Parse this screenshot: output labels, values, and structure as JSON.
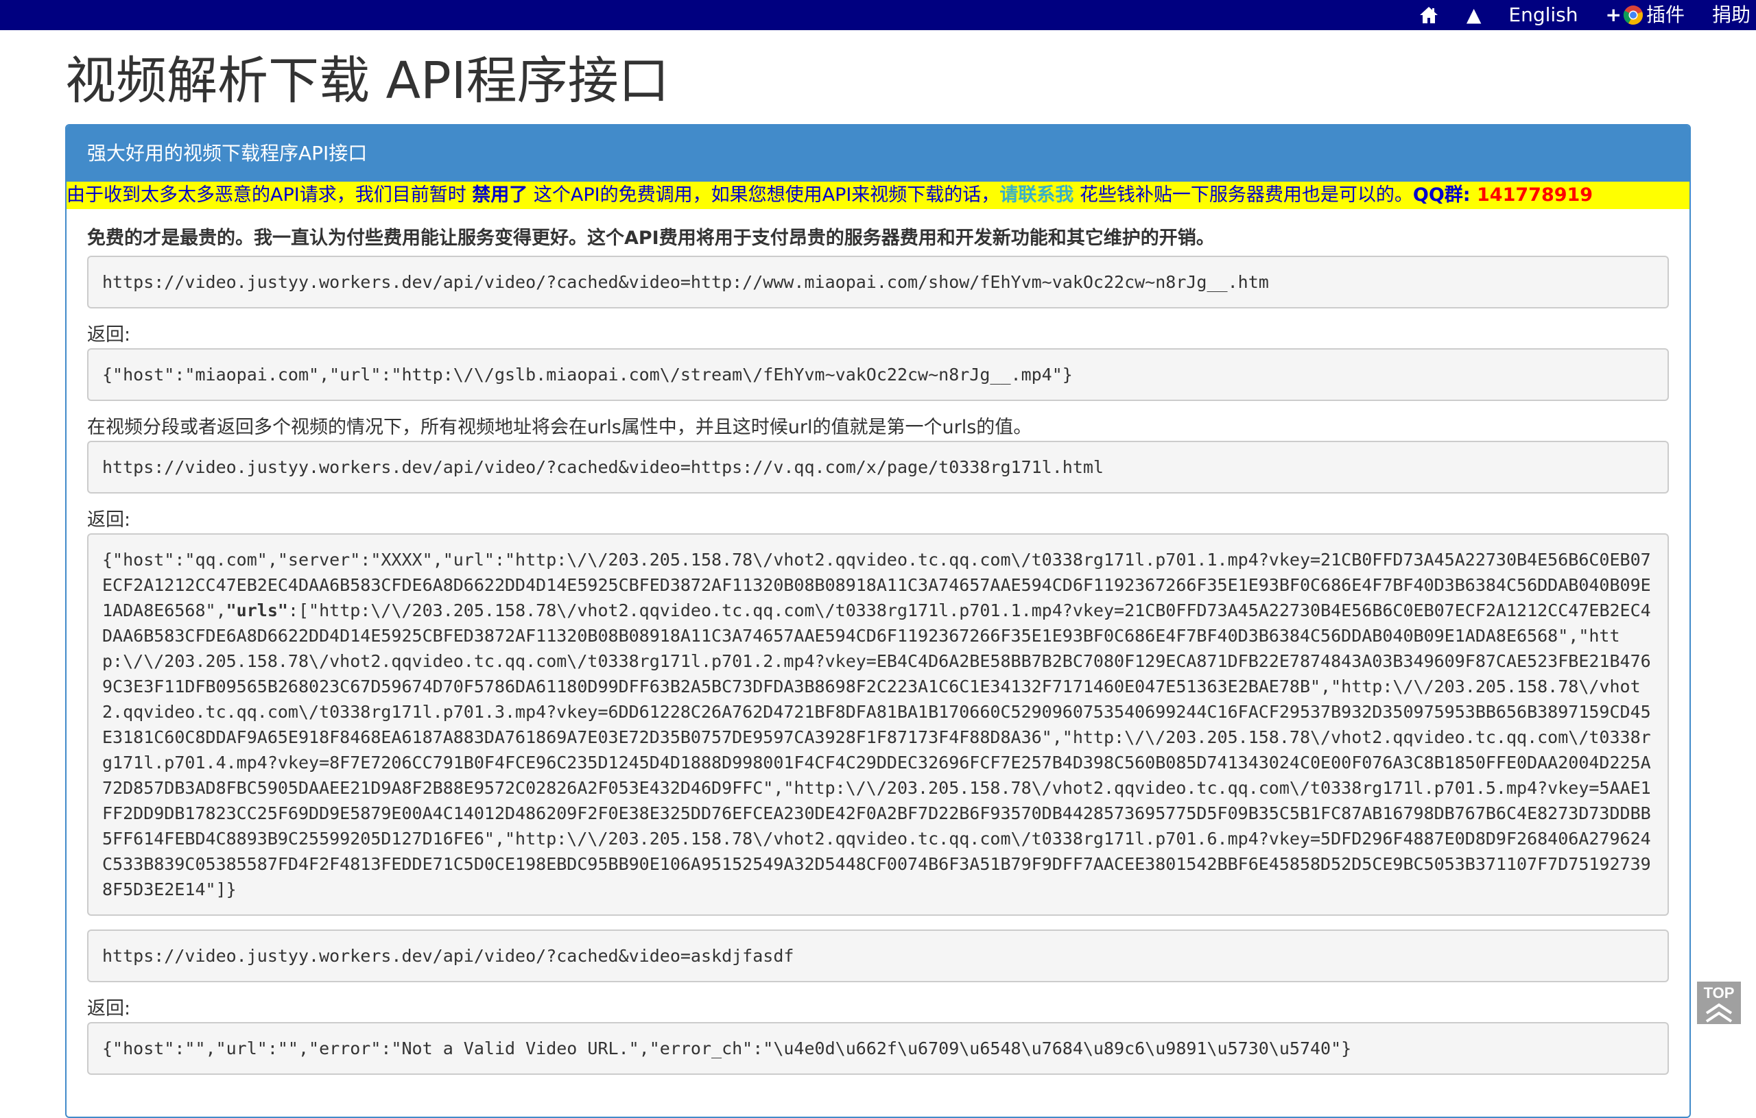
{
  "nav": {
    "arrow": "▲",
    "english": "English",
    "plugin_plus": "+",
    "plugin": "插件",
    "donate": "捐助"
  },
  "title": "视频解析下载 API程序接口",
  "panel": {
    "heading": "强大好用的视频下载程序API接口",
    "notice": {
      "part1": "由于收到太多太多恶意的API请求，我们目前暂时 ",
      "disabled": "禁用了",
      "part2": " 这个API的免费调用，如果您想使用API来视频下载的话，",
      "contact": "请联系我",
      "part3": " 花些钱补贴一下服务器费用也是可以的。",
      "qq_label": "QQ群: ",
      "qq_number": "141778919"
    },
    "lead": "免费的才是最贵的。我一直认为付些费用能让服务变得更好。这个API费用将用于支付昂贵的服务器费用和开发新功能和其它维护的开销。",
    "example1_url": "https://video.justyy.workers.dev/api/video/?cached&video=http://www.miaopai.com/show/fEhYvm~vakOc22cw~n8rJg__.htm",
    "return_label": "返回:",
    "example1_response": "{\"host\":\"miaopai.com\",\"url\":\"http:\\/\\/gslb.miaopai.com\\/stream\\/fEhYvm~vakOc22cw~n8rJg__.mp4\"}",
    "multi_note": "在视频分段或者返回多个视频的情况下，所有视频地址将会在urls属性中，并且这时候url的值就是第一个urls的值。",
    "example2_url": "https://video.justyy.workers.dev/api/video/?cached&video=https://v.qq.com/x/page/t0338rg171l.html",
    "example2_response_a": "{\"host\":\"qq.com\",\"server\":\"XXXX\",\"url\":\"http:\\/\\/203.205.158.78\\/vhot2.qqvideo.tc.qq.com\\/t0338rg171l.p701.1.mp4?vkey=21CB0FFD73A45A22730B4E56B6C0EB07ECF2A1212CC47EB2EC4DAA6B583CFDE6A8D6622DD4D14E5925CBFED3872AF11320B08B08918A11C3A74657AAE594CD6F1192367266F35E1E93BF0C686E4F7BF40D3B6384C56DDAB040B09E1ADA8E6568\",",
    "example2_response_urls_key": "\"urls\"",
    "example2_response_b": ":[\"http:\\/\\/203.205.158.78\\/vhot2.qqvideo.tc.qq.com\\/t0338rg171l.p701.1.mp4?vkey=21CB0FFD73A45A22730B4E56B6C0EB07ECF2A1212CC47EB2EC4DAA6B583CFDE6A8D6622DD4D14E5925CBFED3872AF11320B08B08918A11C3A74657AAE594CD6F1192367266F35E1E93BF0C686E4F7BF40D3B6384C56DDAB040B09E1ADA8E6568\",\"http:\\/\\/203.205.158.78\\/vhot2.qqvideo.tc.qq.com\\/t0338rg171l.p701.2.mp4?vkey=EB4C4D6A2BE58BB7B2BC7080F129ECA871DFB22E7874843A03B349609F87CAE523FBE21B4769C3E3F11DFB09565B268023C67D59674D70F5786DA61180D99DFF63B2A5BC73DFDA3B8698F2C223A1C6C1E34132F7171460E047E51363E2BAE78B\",\"http:\\/\\/203.205.158.78\\/vhot2.qqvideo.tc.qq.com\\/t0338rg171l.p701.3.mp4?vkey=6DD61228C26A762D4721BF8DFA81BA1B170660C5290960753540699244C16FACF29537B932D350975953BB656B3897159CD45E3181C60C8DDAF9A65E918F8468EA6187A883DA761869A7E03E72D35B0757DE9597CA3928F1F87173F4F88D8A36\",\"http:\\/\\/203.205.158.78\\/vhot2.qqvideo.tc.qq.com\\/t0338rg171l.p701.4.mp4?vkey=8F7E7206CC791B0F4FCE96C235D1245D4D1888D998001F4CF4C29DDEC32696FCF7E257B4D398C560B085D741343024C0E00F076A3C8B1850FFE0DAA2004D225A72D857DB3AD8FBC5905DAAEE21D9A8F2B88E9572C02826A2F053E432D46D9FFC\",\"http:\\/\\/203.205.158.78\\/vhot2.qqvideo.tc.qq.com\\/t0338rg171l.p701.5.mp4?vkey=5AAE1FF2DD9DB17823CC25F69DD9E5879E00A4C14012D486209F2F0E38E325DD76EFCEA230DE42F0A2BF7D22B6F93570DB4428573695775D5F09B35C5B1FC87AB16798DB767B6C4E8273D73DDBB5FF614FEBD4C8893B9C25599205D127D16FE6\",\"http:\\/\\/203.205.158.78\\/vhot2.qqvideo.tc.qq.com\\/t0338rg171l.p701.6.mp4?vkey=5DFD296F4887E0D8D9F268406A279624C533B839C05385587FD4F2F4813FEDDE71C5D0CE198EBDC95BB90E106A95152549A32D5448CF0074B6F3A51B79F9DFF7AACEE3801542BBF6E45858D52D5CE9BC5053B371107F7D751927398F5D3E2E14\"]}",
    "example3_url": "https://video.justyy.workers.dev/api/video/?cached&video=askdjfasdf",
    "example3_response": "{\"host\":\"\",\"url\":\"\",\"error\":\"Not a Valid Video URL.\",\"error_ch\":\"\\u4e0d\\u662f\\u6709\\u6548\\u7684\\u89c6\\u9891\\u5730\\u5740\"}"
  },
  "to_top": "TOP",
  "colors": {
    "topbar": "#000080",
    "panel": "#428bca",
    "notice_bg": "#ffff00",
    "qq_number": "#ff0000"
  }
}
